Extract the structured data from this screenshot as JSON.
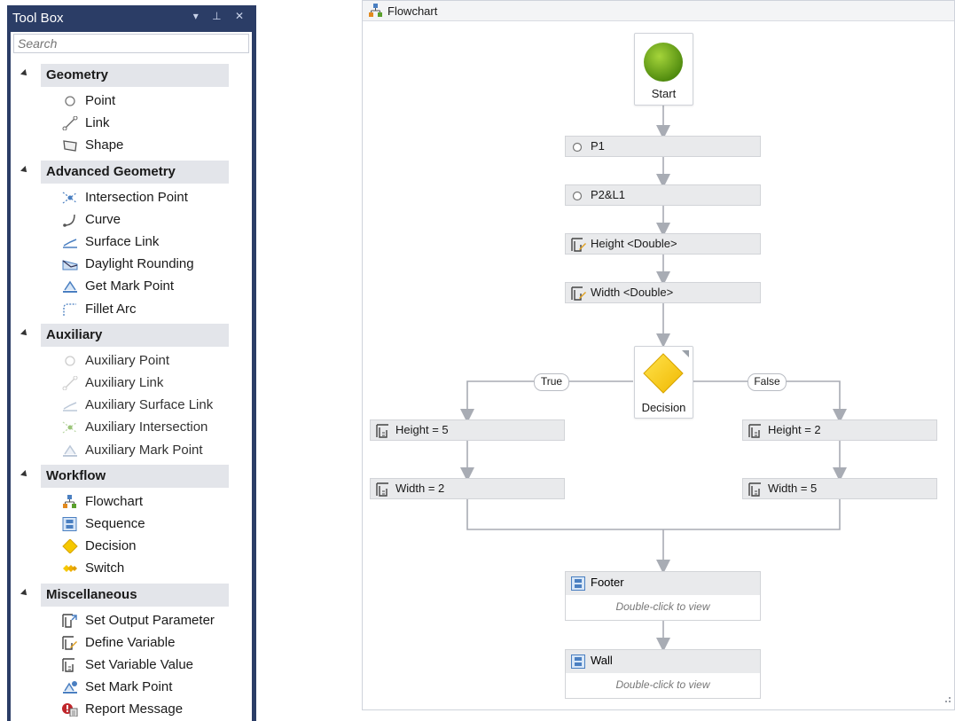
{
  "toolbox": {
    "title": "Tool Box",
    "controls": "▾ ⊥ ✕",
    "search_placeholder": "Search",
    "categories": [
      {
        "label": "Geometry",
        "items": [
          {
            "label": "Point",
            "icon": "point-icon"
          },
          {
            "label": "Link",
            "icon": "link-icon"
          },
          {
            "label": "Shape",
            "icon": "shape-icon"
          }
        ]
      },
      {
        "label": "Advanced Geometry",
        "items": [
          {
            "label": "Intersection Point",
            "icon": "intersection-point-icon"
          },
          {
            "label": "Curve",
            "icon": "curve-icon"
          },
          {
            "label": "Surface Link",
            "icon": "surface-link-icon"
          },
          {
            "label": "Daylight Rounding",
            "icon": "daylight-rounding-icon"
          },
          {
            "label": "Get Mark Point",
            "icon": "get-mark-point-icon"
          },
          {
            "label": "Fillet Arc",
            "icon": "fillet-arc-icon"
          }
        ]
      },
      {
        "label": "Auxiliary",
        "items": [
          {
            "label": "Auxiliary Point",
            "icon": "auxiliary-point-icon"
          },
          {
            "label": "Auxiliary Link",
            "icon": "auxiliary-link-icon"
          },
          {
            "label": "Auxiliary Surface Link",
            "icon": "auxiliary-surface-link-icon"
          },
          {
            "label": "Auxiliary Intersection",
            "icon": "auxiliary-intersection-icon"
          },
          {
            "label": "Auxiliary Mark Point",
            "icon": "auxiliary-mark-point-icon"
          }
        ]
      },
      {
        "label": "Workflow",
        "items": [
          {
            "label": "Flowchart",
            "icon": "flowchart-icon"
          },
          {
            "label": "Sequence",
            "icon": "sequence-icon"
          },
          {
            "label": "Decision",
            "icon": "decision-icon"
          },
          {
            "label": "Switch",
            "icon": "switch-icon"
          }
        ]
      },
      {
        "label": "Miscellaneous",
        "items": [
          {
            "label": "Set Output Parameter",
            "icon": "set-output-parameter-icon"
          },
          {
            "label": "Define Variable",
            "icon": "define-variable-icon"
          },
          {
            "label": "Set Variable Value",
            "icon": "set-variable-value-icon"
          },
          {
            "label": "Set Mark Point",
            "icon": "set-mark-point-icon"
          },
          {
            "label": "Report Message",
            "icon": "report-message-icon"
          }
        ]
      }
    ]
  },
  "flowchart": {
    "title": "Flowchart",
    "start_label": "Start",
    "decision_label": "Decision",
    "true_label": "True",
    "false_label": "False",
    "activities": {
      "p1": "P1",
      "p2l1": "P2&L1",
      "height_var": "Height <Double>",
      "width_var": "Width <Double>",
      "height_true": "Height = 5",
      "width_true": "Width = 2",
      "height_false": "Height = 2",
      "width_false": "Width = 5"
    },
    "footer": {
      "label": "Footer",
      "hint": "Double-click to view"
    },
    "wall": {
      "label": "Wall",
      "hint": "Double-click to view"
    }
  },
  "colors": {
    "panel_header": "#2b3d66",
    "category_bg": "#e3e5ea",
    "start_green": "#6ba318",
    "decision_yellow": "#f5c800",
    "connector": "#a8acb4"
  }
}
